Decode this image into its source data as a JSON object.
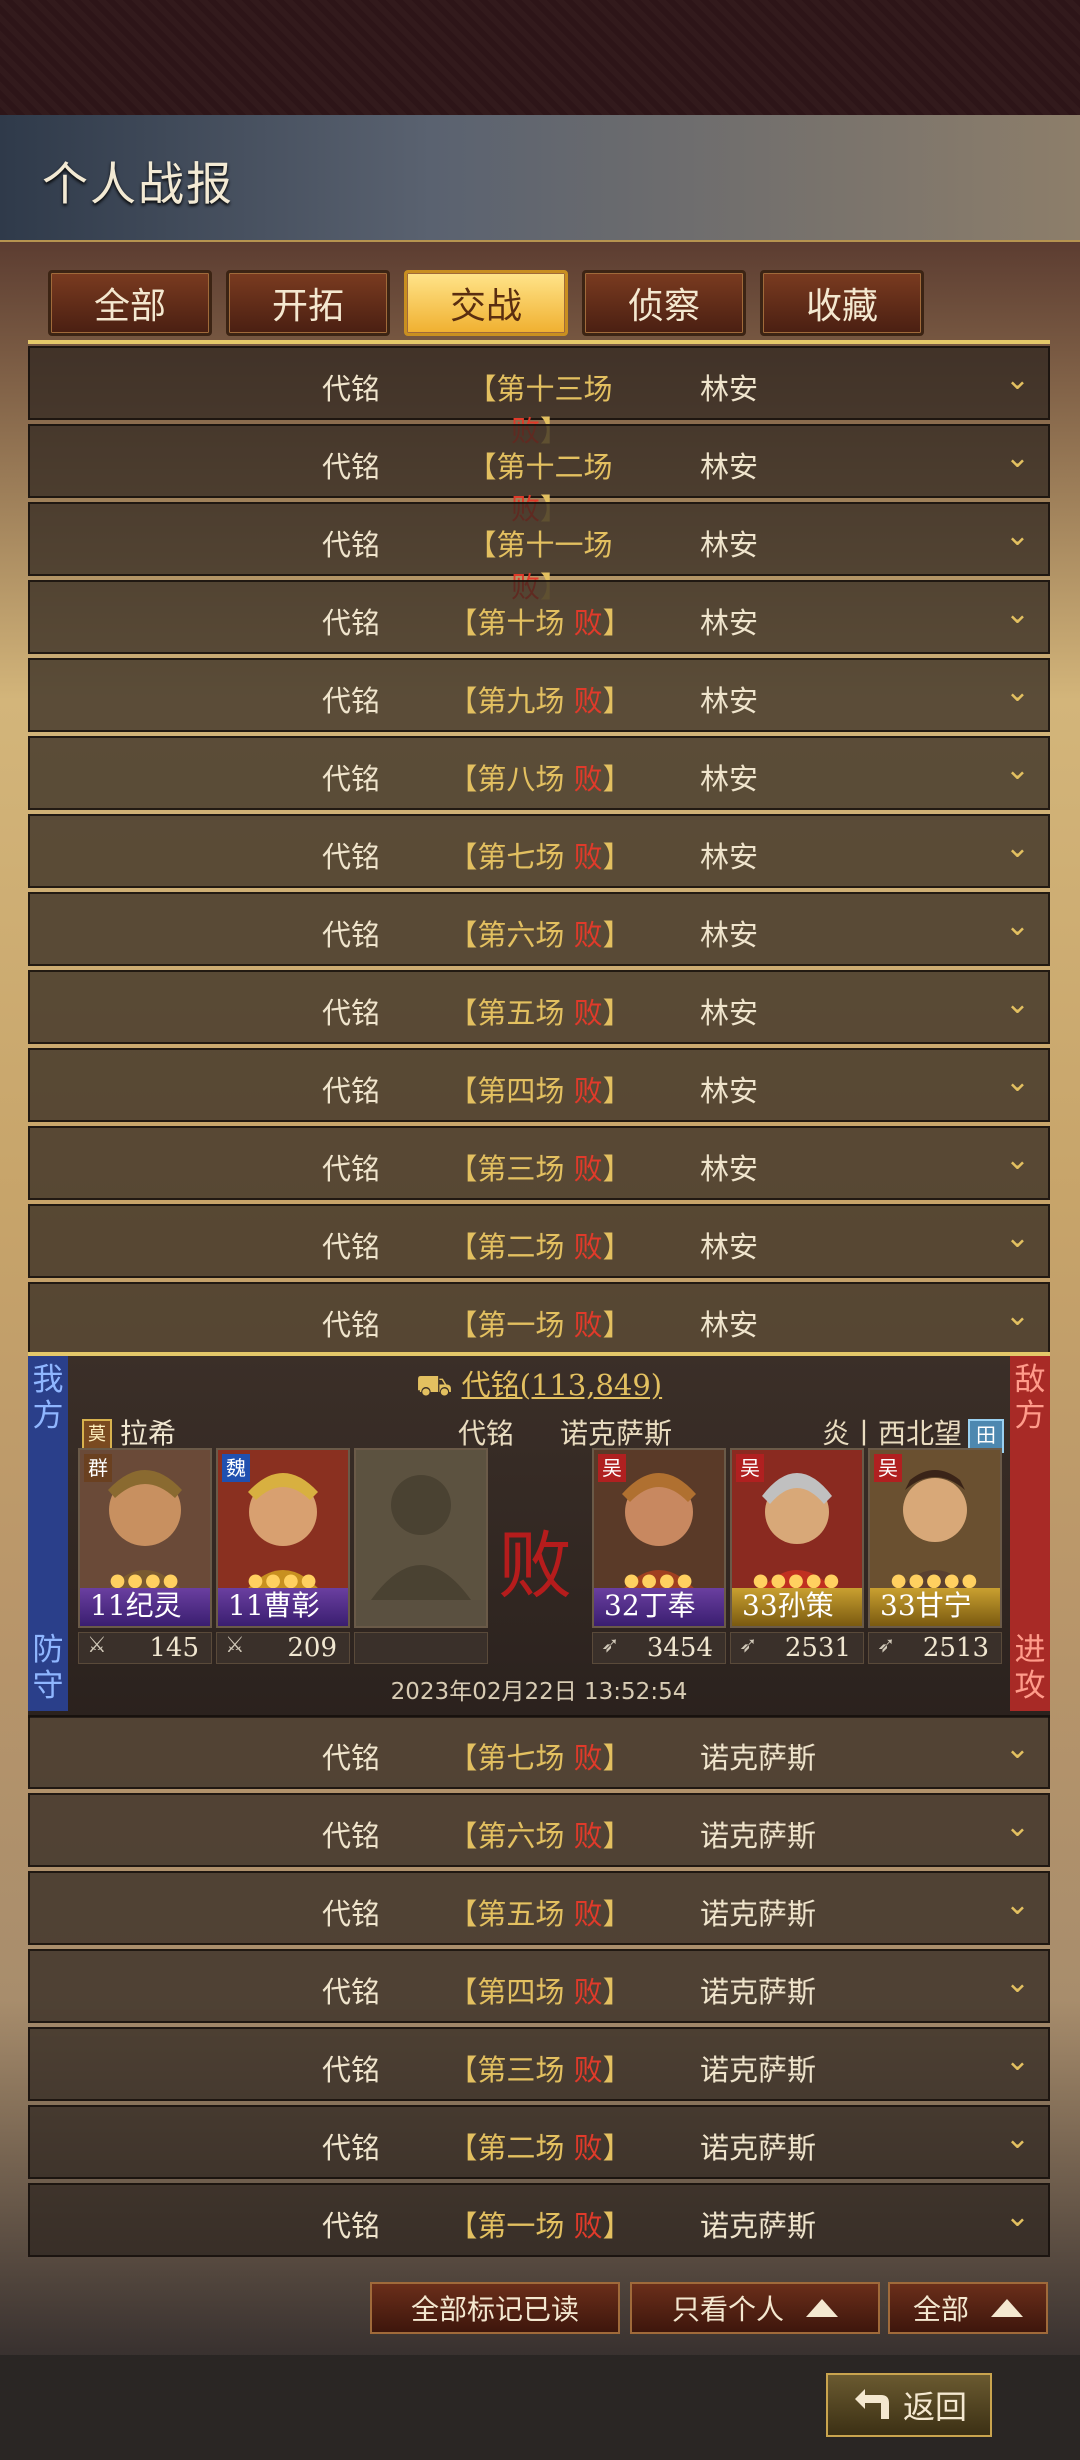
{
  "header": {
    "title": "个人战报"
  },
  "tabs": [
    {
      "label": "全部",
      "active": false
    },
    {
      "label": "开拓",
      "active": false
    },
    {
      "label": "交战",
      "active": true
    },
    {
      "label": "侦察",
      "active": false
    },
    {
      "label": "收藏",
      "active": false
    }
  ],
  "reports_top": [
    {
      "name": "代铭",
      "title_pre": "【第十三场 ",
      "result": "败",
      "title_post": "】",
      "opponent": "林安"
    },
    {
      "name": "代铭",
      "title_pre": "【第十二场 ",
      "result": "败",
      "title_post": "】",
      "opponent": "林安"
    },
    {
      "name": "代铭",
      "title_pre": "【第十一场 ",
      "result": "败",
      "title_post": "】",
      "opponent": "林安"
    },
    {
      "name": "代铭",
      "title_pre": "【第十场 ",
      "result": "败",
      "title_post": "】",
      "opponent": "林安"
    },
    {
      "name": "代铭",
      "title_pre": "【第九场 ",
      "result": "败",
      "title_post": "】",
      "opponent": "林安"
    },
    {
      "name": "代铭",
      "title_pre": "【第八场 ",
      "result": "败",
      "title_post": "】",
      "opponent": "林安"
    },
    {
      "name": "代铭",
      "title_pre": "【第七场 ",
      "result": "败",
      "title_post": "】",
      "opponent": "林安"
    },
    {
      "name": "代铭",
      "title_pre": "【第六场 ",
      "result": "败",
      "title_post": "】",
      "opponent": "林安"
    },
    {
      "name": "代铭",
      "title_pre": "【第五场 ",
      "result": "败",
      "title_post": "】",
      "opponent": "林安"
    },
    {
      "name": "代铭",
      "title_pre": "【第四场 ",
      "result": "败",
      "title_post": "】",
      "opponent": "林安"
    },
    {
      "name": "代铭",
      "title_pre": "【第三场 ",
      "result": "败",
      "title_post": "】",
      "opponent": "林安"
    },
    {
      "name": "代铭",
      "title_pre": "【第二场 ",
      "result": "败",
      "title_post": "】",
      "opponent": "林安"
    },
    {
      "name": "代铭",
      "title_pre": "【第一场 ",
      "result": "败",
      "title_post": "】",
      "opponent": "林安"
    }
  ],
  "detail": {
    "side_left_top": "我方",
    "side_left_bottom": "防守",
    "side_right_top": "敌方",
    "side_right_bottom": "进攻",
    "attacker_line": "代铭(113,849)",
    "left_player": "拉希",
    "left_flag": "莫",
    "mid_name": "代铭",
    "mid_opponent": "诺克萨斯",
    "right_player": "炎丨西北望",
    "right_flag": "田",
    "result": "败",
    "timestamp": "2023年02月22日 13:52:54",
    "left_generals": [
      {
        "faction": "群",
        "level_name": "11纪灵",
        "troops": "145",
        "pips": "●●●●"
      },
      {
        "faction": "魏",
        "level_name": "11曹彰",
        "troops": "209",
        "pips": "●●●●"
      },
      {
        "faction": "",
        "level_name": "",
        "troops": "",
        "pips": ""
      }
    ],
    "right_generals": [
      {
        "faction": "吴",
        "level_name": "32丁奉",
        "troops": "3454",
        "pips": "●●●●"
      },
      {
        "faction": "吴",
        "level_name": "33孙策",
        "troops": "2531",
        "pips": "●●●●●"
      },
      {
        "faction": "吴",
        "level_name": "33甘宁",
        "troops": "2513",
        "pips": "●●●●●"
      }
    ]
  },
  "reports_bottom": [
    {
      "name": "代铭",
      "title_pre": "【第七场 ",
      "result": "败",
      "title_post": "】",
      "opponent": "诺克萨斯"
    },
    {
      "name": "代铭",
      "title_pre": "【第六场 ",
      "result": "败",
      "title_post": "】",
      "opponent": "诺克萨斯"
    },
    {
      "name": "代铭",
      "title_pre": "【第五场 ",
      "result": "败",
      "title_post": "】",
      "opponent": "诺克萨斯"
    },
    {
      "name": "代铭",
      "title_pre": "【第四场 ",
      "result": "败",
      "title_post": "】",
      "opponent": "诺克萨斯"
    },
    {
      "name": "代铭",
      "title_pre": "【第三场 ",
      "result": "败",
      "title_post": "】",
      "opponent": "诺克萨斯"
    },
    {
      "name": "代铭",
      "title_pre": "【第二场 ",
      "result": "败",
      "title_post": "】",
      "opponent": "诺克萨斯"
    },
    {
      "name": "代铭",
      "title_pre": "【第一场 ",
      "result": "败",
      "title_post": "】",
      "opponent": "诺克萨斯"
    }
  ],
  "footer": {
    "mark_all_read": "全部标记已读",
    "only_personal": "只看个人",
    "all": "全部",
    "back": "返回"
  },
  "colors": {
    "accent": "#e3c060",
    "lose": "#e03a2a",
    "tab_active": "#f0b030"
  }
}
